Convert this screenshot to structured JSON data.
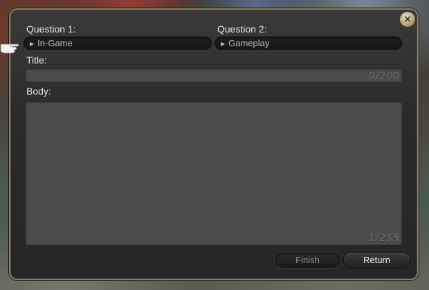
{
  "dialog": {
    "close_icon": "close-icon"
  },
  "question1": {
    "label": "Question 1:",
    "value": "In-Game"
  },
  "question2": {
    "label": "Question 2:",
    "value": "Gameplay"
  },
  "title": {
    "label": "Title:",
    "value": "",
    "counter": "0/200"
  },
  "body": {
    "label": "Body:",
    "value": "",
    "counter": "1/255"
  },
  "buttons": {
    "finish": "Finish",
    "return": "Return"
  },
  "cursor_icon": "hand-pointer-icon",
  "colors": {
    "frame": "#8a7d63",
    "window_bg": "#2c2c2c",
    "field_bg": "#4b4b4b"
  }
}
